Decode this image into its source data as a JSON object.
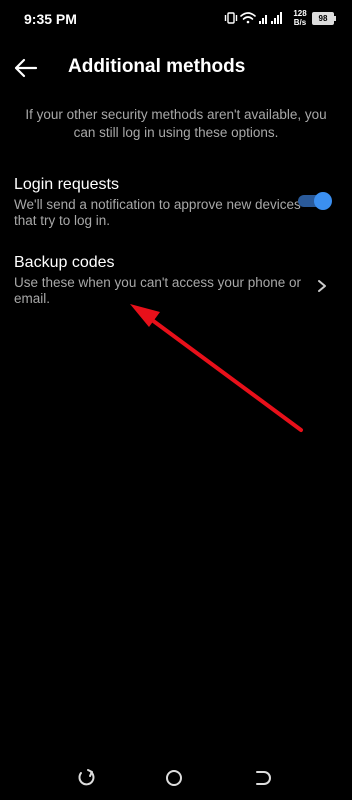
{
  "status_bar": {
    "time": "9:35 PM",
    "net_speed_value": "128",
    "net_speed_unit": "B/s",
    "battery": "98"
  },
  "header": {
    "title": "Additional methods",
    "back_icon": "arrow-left-icon"
  },
  "intro": {
    "text": "If your other security methods aren't available, you can still log in using these options."
  },
  "items": [
    {
      "title": "Login requests",
      "description": "We'll send a notification to approve new devices that try to log in.",
      "toggle_on": true,
      "accent": "#3b8ff0"
    },
    {
      "title": "Backup codes",
      "description": "Use these when you can't access your phone or email.",
      "icon": "chevron-right-icon"
    }
  ],
  "annotation": {
    "color": "#e8101a"
  },
  "nav_bar": {
    "buttons": [
      "recents-icon",
      "home-icon",
      "back-icon"
    ]
  }
}
